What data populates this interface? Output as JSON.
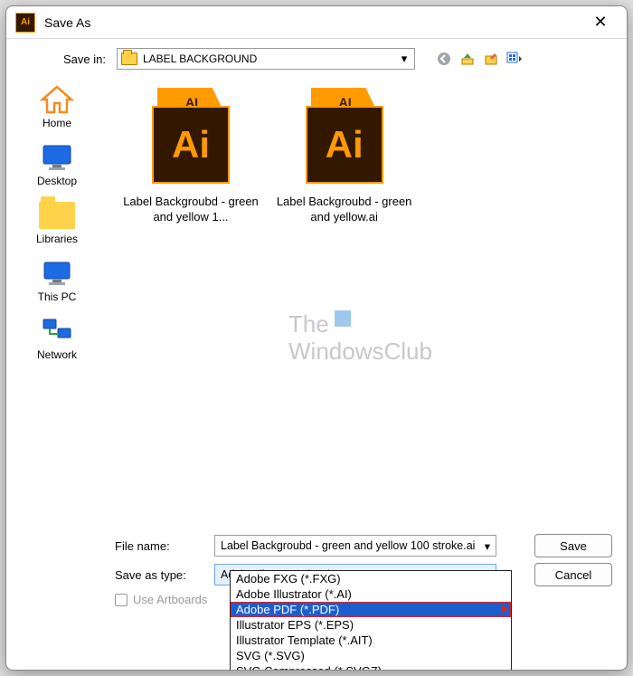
{
  "window": {
    "title": "Save As",
    "app_icon_label": "Ai"
  },
  "save_in": {
    "label": "Save in:",
    "folder": "LABEL BACKGROUND"
  },
  "nav_icons": {
    "back": "←",
    "up": "↑",
    "new": "⎘",
    "views": "▦"
  },
  "sidebar": {
    "items": [
      {
        "key": "home",
        "label": "Home"
      },
      {
        "key": "desktop",
        "label": "Desktop"
      },
      {
        "key": "libraries",
        "label": "Libraries"
      },
      {
        "key": "thispc",
        "label": "This PC"
      },
      {
        "key": "network",
        "label": "Network"
      }
    ]
  },
  "files": {
    "ai_icon_top": "AI",
    "ai_icon_body": "Ai",
    "items": [
      {
        "name": "Label Backgroubd - green and yellow 1..."
      },
      {
        "name": "Label Backgroubd - green and yellow.ai"
      }
    ]
  },
  "watermark": {
    "line1": "The",
    "line2": "WindowsClub"
  },
  "file_name": {
    "label": "File name:",
    "value": "Label Backgroubd - green and yellow 100 stroke.ai"
  },
  "save_type": {
    "label": "Save as type:",
    "value": "Adobe Illustrator (*.AI)",
    "options": [
      "Adobe FXG (*.FXG)",
      "Adobe Illustrator (*.AI)",
      "Adobe PDF (*.PDF)",
      "Illustrator EPS (*.EPS)",
      "Illustrator Template (*.AIT)",
      "SVG (*.SVG)",
      "SVG Compressed (*.SVGZ)"
    ],
    "highlighted_index": 2
  },
  "buttons": {
    "save": "Save",
    "cancel": "Cancel"
  },
  "artboards": {
    "label": "Use Artboards"
  }
}
